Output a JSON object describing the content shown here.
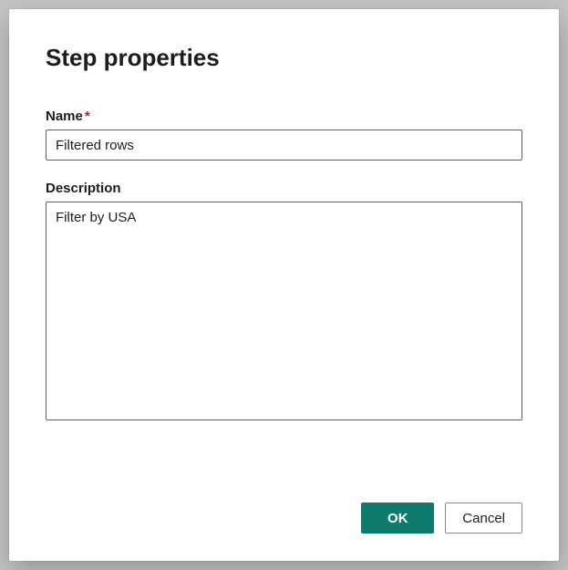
{
  "dialog": {
    "title": "Step properties",
    "fields": {
      "name": {
        "label": "Name",
        "required_mark": "*",
        "value": "Filtered rows"
      },
      "description": {
        "label": "Description",
        "value": "Filter by USA"
      }
    },
    "buttons": {
      "ok": "OK",
      "cancel": "Cancel"
    }
  }
}
